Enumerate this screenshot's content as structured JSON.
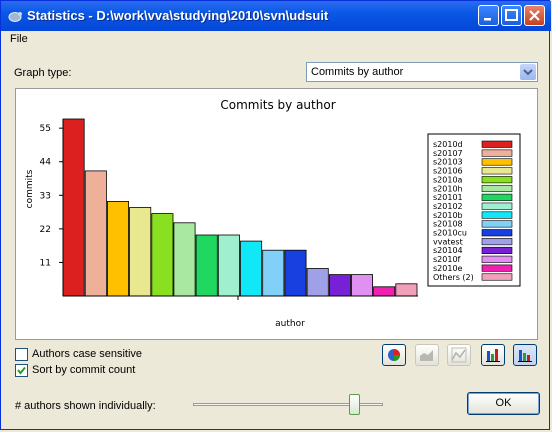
{
  "window": {
    "title": "Statistics - D:\\work\\vva\\studying\\2010\\svn\\udsuit",
    "icon": "tortoise-icon"
  },
  "menu": {
    "items": [
      "File"
    ]
  },
  "graph_type": {
    "label": "Graph type:",
    "selected": "Commits by author"
  },
  "chart_data": {
    "type": "bar",
    "title": "Commits by author",
    "xlabel": "author",
    "ylabel": "commits",
    "yticks": [
      11,
      22,
      33,
      44,
      55
    ],
    "ylim": [
      0,
      58
    ],
    "grid": false,
    "legend_position": "right",
    "categories": [
      "s2010d",
      "s20107",
      "s20103",
      "s20106",
      "s2010a",
      "s2010h",
      "s20101",
      "s20102",
      "s2010b",
      "s20108",
      "s2010cu",
      "vvatest",
      "s20104",
      "s2010f",
      "s2010e",
      "Others (2)"
    ],
    "values": [
      58,
      41,
      31,
      29,
      27,
      24,
      20,
      20,
      18,
      15,
      15,
      9,
      7,
      7,
      3,
      4
    ],
    "colors": [
      "#dc2020",
      "#eeb098",
      "#ffc000",
      "#e8e890",
      "#88e020",
      "#a8e8a0",
      "#20d860",
      "#a0f0d0",
      "#10e8f8",
      "#80d0f8",
      "#1840e0",
      "#a0a0e8",
      "#7820d8",
      "#e090f0",
      "#f020b0",
      "#f0a0b8"
    ]
  },
  "options": {
    "case_sensitive": {
      "label": "Authors case sensitive",
      "checked": false
    },
    "sort_by_count": {
      "label": "Sort by commit count",
      "checked": true
    }
  },
  "view_buttons": [
    {
      "name": "pie-chart-icon",
      "enabled": true,
      "active": false
    },
    {
      "name": "area-chart-icon",
      "enabled": false,
      "active": false
    },
    {
      "name": "line-chart-icon",
      "enabled": false,
      "active": false
    },
    {
      "name": "stacked-bar-icon",
      "enabled": true,
      "active": false
    },
    {
      "name": "bar-chart-icon",
      "enabled": true,
      "active": true
    }
  ],
  "slider": {
    "label": "# authors shown individually:",
    "value_fraction": 0.85
  },
  "ok_label": "OK"
}
